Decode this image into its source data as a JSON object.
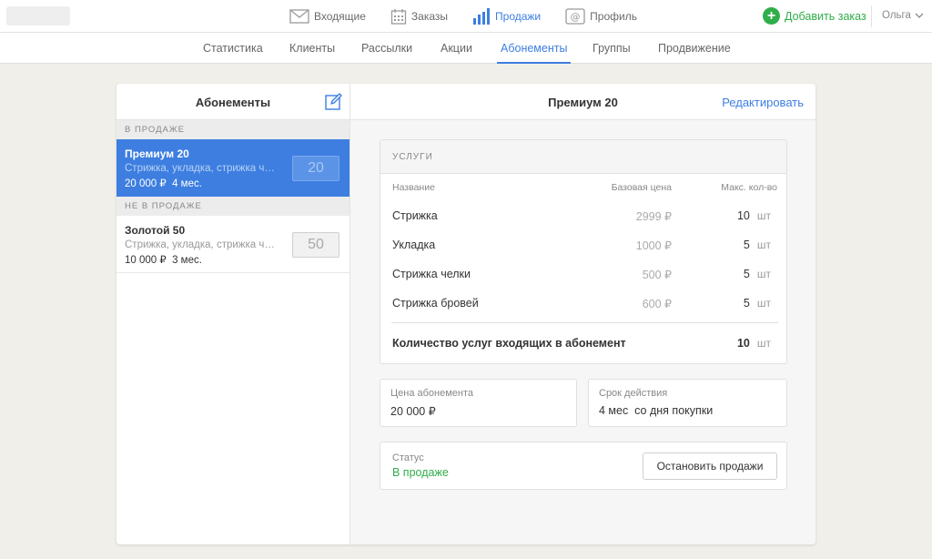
{
  "topbar": {
    "nav": [
      {
        "label": "Входящие",
        "icon": "envelope-icon"
      },
      {
        "label": "Заказы",
        "icon": "calendar-icon"
      },
      {
        "label": "Продажи",
        "icon": "bar-chart-icon",
        "active": true
      },
      {
        "label": "Профиль",
        "icon": "at-profile-icon"
      }
    ],
    "add_order_label": "Добавить заказ",
    "user_name": "Ольга"
  },
  "subnav": {
    "tabs": [
      {
        "label": "Статистика"
      },
      {
        "label": "Клиенты"
      },
      {
        "label": "Рассылки"
      },
      {
        "label": "Акции"
      },
      {
        "label": "Абонементы",
        "active": true
      },
      {
        "label": "Группы"
      },
      {
        "label": "Продвижение"
      }
    ]
  },
  "sidebar": {
    "title": "Абонементы",
    "groups": [
      {
        "label": "В ПРОДАЖЕ",
        "plans": [
          {
            "name": "Премиум 20",
            "desc": "Стрижка, укладка, стрижка челки, стрижка бровей",
            "price": "20 000 ₽",
            "duration": "4 мес.",
            "badge": "20",
            "selected": true
          }
        ]
      },
      {
        "label": "НЕ В ПРОДАЖЕ",
        "plans": [
          {
            "name": "Золотой 50",
            "desc": "Стрижка, укладка, стрижка челки, стрижка бровей",
            "price": "10 000 ₽",
            "duration": "3 мес.",
            "badge": "50"
          }
        ]
      }
    ]
  },
  "detail": {
    "title": "Премиум 20",
    "edit_label": "Редактировать",
    "services": {
      "header": "УСЛУГИ",
      "columns": {
        "name": "Название",
        "price": "Базовая цена",
        "max": "Макс. кол-во"
      },
      "rows": [
        {
          "name": "Стрижка",
          "price": "2999 ₽",
          "qty": "10",
          "unit": "шт"
        },
        {
          "name": "Укладка",
          "price": "1000 ₽",
          "qty": "5",
          "unit": "шт"
        },
        {
          "name": "Стрижка челки",
          "price": "500 ₽",
          "qty": "5",
          "unit": "шт"
        },
        {
          "name": "Стрижка бровей",
          "price": "600 ₽",
          "qty": "5",
          "unit": "шт"
        }
      ],
      "total_label": "Количество услуг входящих в абонемент",
      "total_qty": "10",
      "total_unit": "шт"
    },
    "price_field": {
      "label": "Цена абонемента",
      "value": "20 000 ₽"
    },
    "term_field": {
      "label": "Срок действия",
      "value": "4 мес  со дня покупки"
    },
    "status": {
      "label": "Статус",
      "value": "В продаже",
      "button": "Остановить продажи"
    }
  },
  "colors": {
    "accent": "#3d7ee0",
    "success": "#2fae4a",
    "background": "#f1efea"
  }
}
